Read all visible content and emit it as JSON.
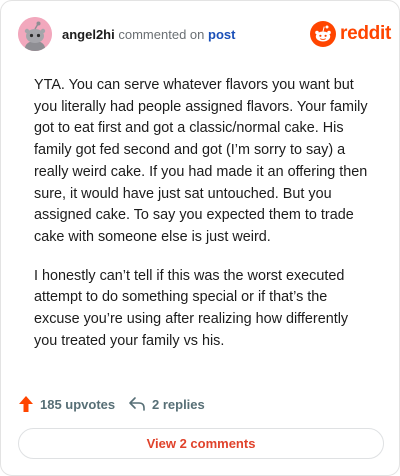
{
  "header": {
    "username": "angel2hi",
    "action_text": "commented on",
    "post_link": "post",
    "brand_word": "reddit",
    "avatar_icon": "snoo-avatar-icon",
    "brand_icon": "reddit-logo-icon"
  },
  "comment": {
    "paragraphs": [
      "YTA. You can serve whatever flavors you want but you literally had people assigned flavors. Your family got to eat first and got a classic/normal cake. His family got fed second and got (I’m sorry to say) a really weird cake. If you had made it an offering then sure, it would have just sat untouched. But you assigned cake. To say you expected them to trade cake with someone else is just weird.",
      "I honestly can’t tell if this was the worst executed attempt to do something special or if that’s the excuse you’re using after realizing how differently you treated your family vs his."
    ]
  },
  "actions": {
    "upvotes_label": "185 upvotes",
    "replies_label": "2 replies",
    "upvote_icon": "upvote-arrow-icon",
    "reply_icon": "reply-arrow-icon"
  },
  "footer": {
    "view_comments_label": "View 2 comments"
  },
  "colors": {
    "brand": "#ff4500",
    "link": "#1a4fb8",
    "muted": "#576f76",
    "button_text": "#e0422b",
    "avatar_bg": "#f2a8bd"
  }
}
